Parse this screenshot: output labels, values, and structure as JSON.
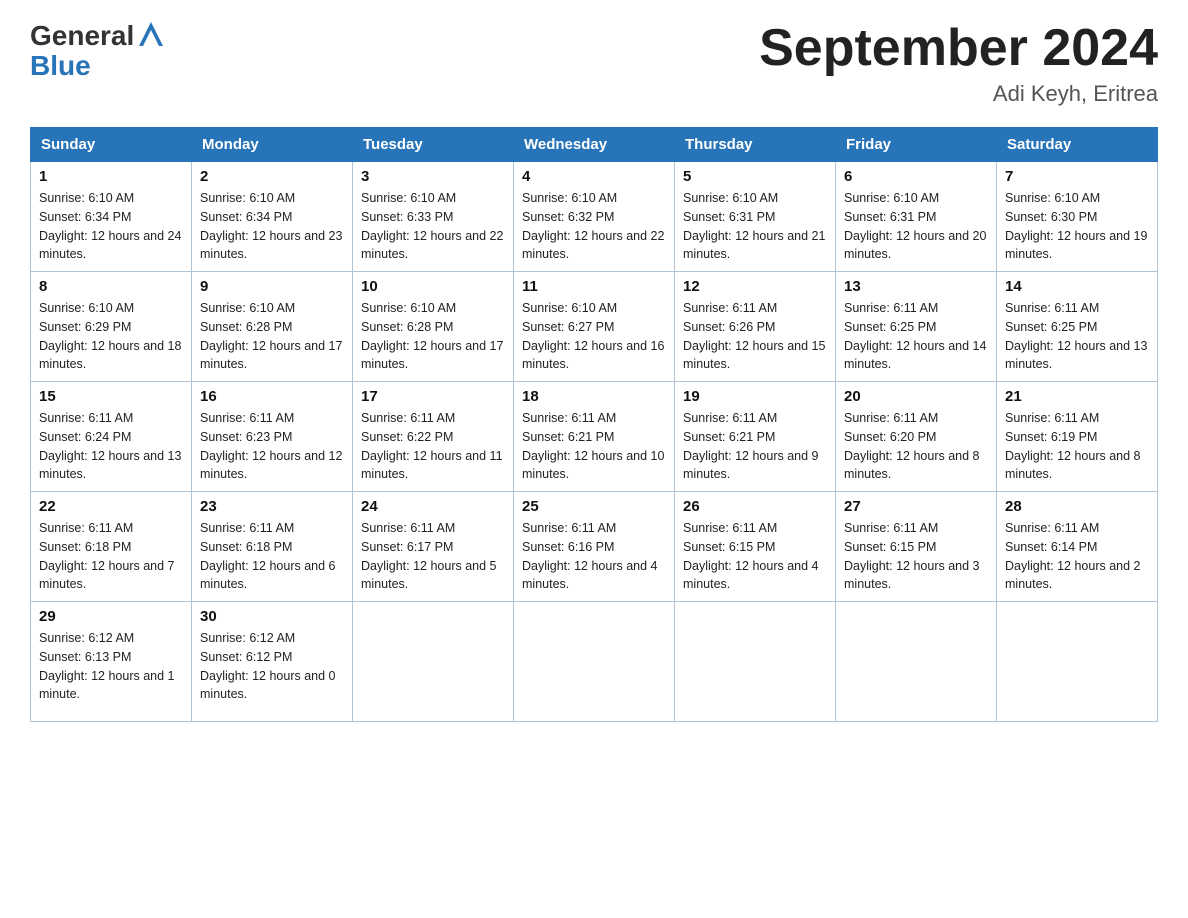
{
  "header": {
    "logo_general": "General",
    "logo_blue": "Blue",
    "title": "September 2024",
    "subtitle": "Adi Keyh, Eritrea"
  },
  "days_of_week": [
    "Sunday",
    "Monday",
    "Tuesday",
    "Wednesday",
    "Thursday",
    "Friday",
    "Saturday"
  ],
  "weeks": [
    [
      {
        "day": "1",
        "sunrise": "6:10 AM",
        "sunset": "6:34 PM",
        "daylight": "12 hours and 24 minutes."
      },
      {
        "day": "2",
        "sunrise": "6:10 AM",
        "sunset": "6:34 PM",
        "daylight": "12 hours and 23 minutes."
      },
      {
        "day": "3",
        "sunrise": "6:10 AM",
        "sunset": "6:33 PM",
        "daylight": "12 hours and 22 minutes."
      },
      {
        "day": "4",
        "sunrise": "6:10 AM",
        "sunset": "6:32 PM",
        "daylight": "12 hours and 22 minutes."
      },
      {
        "day": "5",
        "sunrise": "6:10 AM",
        "sunset": "6:31 PM",
        "daylight": "12 hours and 21 minutes."
      },
      {
        "day": "6",
        "sunrise": "6:10 AM",
        "sunset": "6:31 PM",
        "daylight": "12 hours and 20 minutes."
      },
      {
        "day": "7",
        "sunrise": "6:10 AM",
        "sunset": "6:30 PM",
        "daylight": "12 hours and 19 minutes."
      }
    ],
    [
      {
        "day": "8",
        "sunrise": "6:10 AM",
        "sunset": "6:29 PM",
        "daylight": "12 hours and 18 minutes."
      },
      {
        "day": "9",
        "sunrise": "6:10 AM",
        "sunset": "6:28 PM",
        "daylight": "12 hours and 17 minutes."
      },
      {
        "day": "10",
        "sunrise": "6:10 AM",
        "sunset": "6:28 PM",
        "daylight": "12 hours and 17 minutes."
      },
      {
        "day": "11",
        "sunrise": "6:10 AM",
        "sunset": "6:27 PM",
        "daylight": "12 hours and 16 minutes."
      },
      {
        "day": "12",
        "sunrise": "6:11 AM",
        "sunset": "6:26 PM",
        "daylight": "12 hours and 15 minutes."
      },
      {
        "day": "13",
        "sunrise": "6:11 AM",
        "sunset": "6:25 PM",
        "daylight": "12 hours and 14 minutes."
      },
      {
        "day": "14",
        "sunrise": "6:11 AM",
        "sunset": "6:25 PM",
        "daylight": "12 hours and 13 minutes."
      }
    ],
    [
      {
        "day": "15",
        "sunrise": "6:11 AM",
        "sunset": "6:24 PM",
        "daylight": "12 hours and 13 minutes."
      },
      {
        "day": "16",
        "sunrise": "6:11 AM",
        "sunset": "6:23 PM",
        "daylight": "12 hours and 12 minutes."
      },
      {
        "day": "17",
        "sunrise": "6:11 AM",
        "sunset": "6:22 PM",
        "daylight": "12 hours and 11 minutes."
      },
      {
        "day": "18",
        "sunrise": "6:11 AM",
        "sunset": "6:21 PM",
        "daylight": "12 hours and 10 minutes."
      },
      {
        "day": "19",
        "sunrise": "6:11 AM",
        "sunset": "6:21 PM",
        "daylight": "12 hours and 9 minutes."
      },
      {
        "day": "20",
        "sunrise": "6:11 AM",
        "sunset": "6:20 PM",
        "daylight": "12 hours and 8 minutes."
      },
      {
        "day": "21",
        "sunrise": "6:11 AM",
        "sunset": "6:19 PM",
        "daylight": "12 hours and 8 minutes."
      }
    ],
    [
      {
        "day": "22",
        "sunrise": "6:11 AM",
        "sunset": "6:18 PM",
        "daylight": "12 hours and 7 minutes."
      },
      {
        "day": "23",
        "sunrise": "6:11 AM",
        "sunset": "6:18 PM",
        "daylight": "12 hours and 6 minutes."
      },
      {
        "day": "24",
        "sunrise": "6:11 AM",
        "sunset": "6:17 PM",
        "daylight": "12 hours and 5 minutes."
      },
      {
        "day": "25",
        "sunrise": "6:11 AM",
        "sunset": "6:16 PM",
        "daylight": "12 hours and 4 minutes."
      },
      {
        "day": "26",
        "sunrise": "6:11 AM",
        "sunset": "6:15 PM",
        "daylight": "12 hours and 4 minutes."
      },
      {
        "day": "27",
        "sunrise": "6:11 AM",
        "sunset": "6:15 PM",
        "daylight": "12 hours and 3 minutes."
      },
      {
        "day": "28",
        "sunrise": "6:11 AM",
        "sunset": "6:14 PM",
        "daylight": "12 hours and 2 minutes."
      }
    ],
    [
      {
        "day": "29",
        "sunrise": "6:12 AM",
        "sunset": "6:13 PM",
        "daylight": "12 hours and 1 minute."
      },
      {
        "day": "30",
        "sunrise": "6:12 AM",
        "sunset": "6:12 PM",
        "daylight": "12 hours and 0 minutes."
      },
      {
        "day": "",
        "sunrise": "",
        "sunset": "",
        "daylight": ""
      },
      {
        "day": "",
        "sunrise": "",
        "sunset": "",
        "daylight": ""
      },
      {
        "day": "",
        "sunrise": "",
        "sunset": "",
        "daylight": ""
      },
      {
        "day": "",
        "sunrise": "",
        "sunset": "",
        "daylight": ""
      },
      {
        "day": "",
        "sunrise": "",
        "sunset": "",
        "daylight": ""
      }
    ]
  ]
}
